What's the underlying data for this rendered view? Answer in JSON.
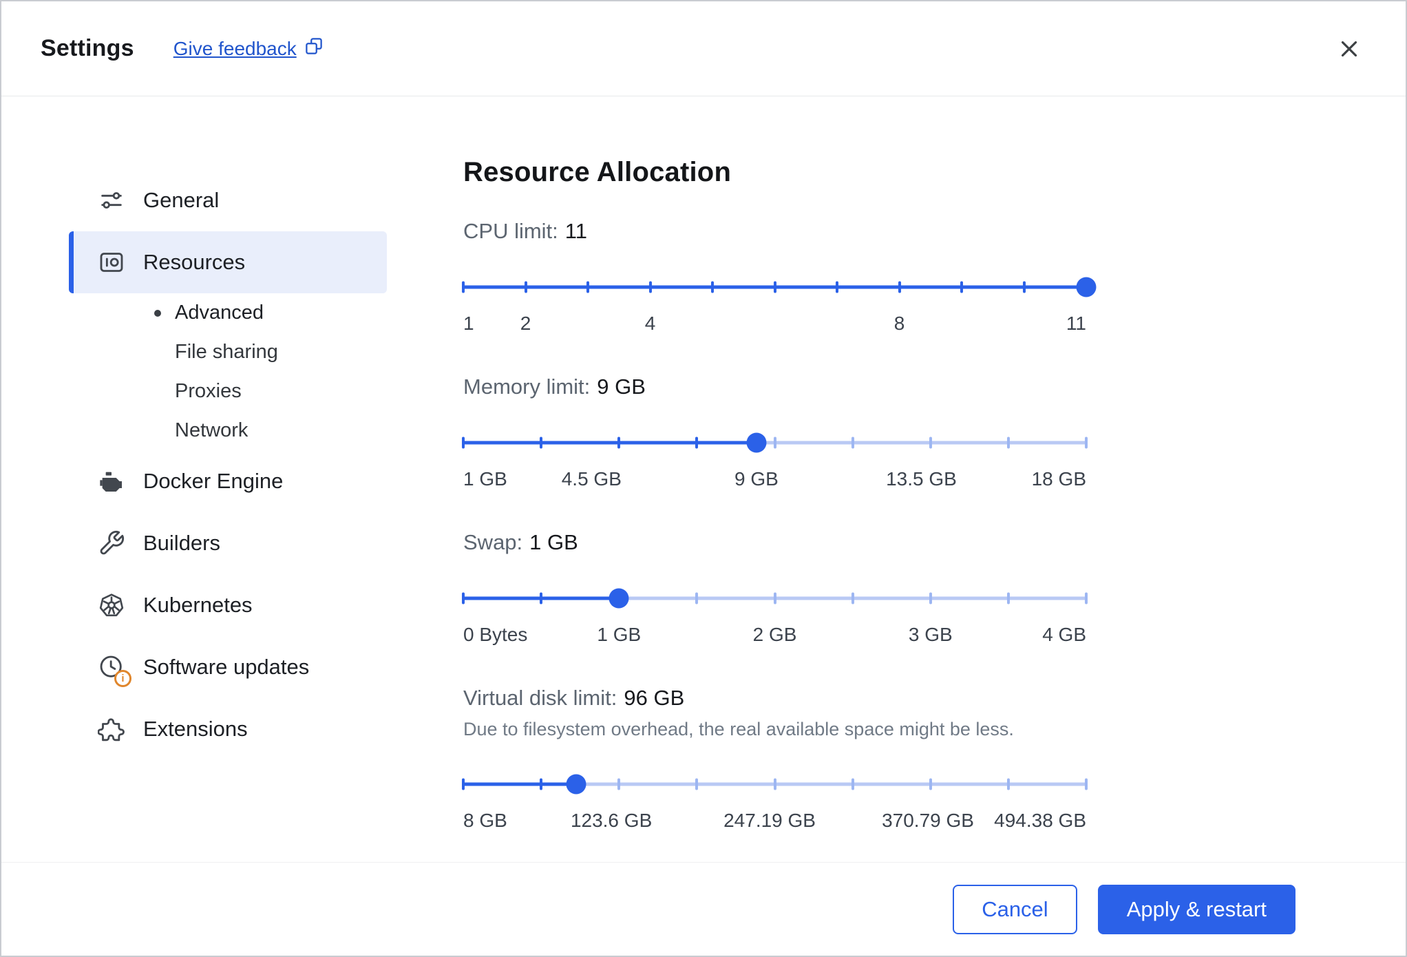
{
  "colors": {
    "accent": "#2b61e8",
    "track_light": "#b9c9f4",
    "tick_light": "#9db6f2",
    "selected_bg": "#e9eefb",
    "warning": "#e0862c",
    "link": "#2155cc"
  },
  "header": {
    "title": "Settings",
    "feedback_label": "Give feedback"
  },
  "sidebar": {
    "items": [
      {
        "type": "item",
        "label": "General",
        "icon": "sliders"
      },
      {
        "type": "item",
        "label": "Resources",
        "icon": "gauge",
        "selected": true
      },
      {
        "type": "sub",
        "label": "Advanced",
        "active": true
      },
      {
        "type": "sub",
        "label": "File sharing"
      },
      {
        "type": "sub",
        "label": "Proxies"
      },
      {
        "type": "sub",
        "label": "Network"
      },
      {
        "type": "item",
        "label": "Docker Engine",
        "icon": "engine"
      },
      {
        "type": "item",
        "label": "Builders",
        "icon": "wrench"
      },
      {
        "type": "item",
        "label": "Kubernetes",
        "icon": "kubernetes"
      },
      {
        "type": "item",
        "label": "Software updates",
        "icon": "clock-update",
        "badge": "info"
      },
      {
        "type": "item",
        "label": "Extensions",
        "icon": "puzzle"
      }
    ]
  },
  "main": {
    "title": "Resource Allocation",
    "sliders": [
      {
        "label": "CPU limit:",
        "value_text": "11",
        "min": 1,
        "max": 11,
        "current": 11,
        "segments": 10,
        "tick_labels": [
          {
            "text": "1",
            "value": 1
          },
          {
            "text": "2",
            "value": 2
          },
          {
            "text": "4",
            "value": 4
          },
          {
            "text": "8",
            "value": 8
          },
          {
            "text": "11",
            "value": 11
          }
        ]
      },
      {
        "label": "Memory limit:",
        "value_text": "9 GB",
        "min": 1,
        "max": 18,
        "current": 9,
        "segments": 8,
        "tick_labels": [
          {
            "text": "1 GB",
            "value": 1
          },
          {
            "text": "4.5 GB",
            "value": 4.5
          },
          {
            "text": "9 GB",
            "value": 9
          },
          {
            "text": "13.5 GB",
            "value": 13.5
          },
          {
            "text": "18 GB",
            "value": 18
          }
        ]
      },
      {
        "label": "Swap:",
        "value_text": "1 GB",
        "min": 0,
        "max": 4,
        "current": 1,
        "segments": 8,
        "tick_labels": [
          {
            "text": "0 Bytes",
            "value": 0
          },
          {
            "text": "1 GB",
            "value": 1
          },
          {
            "text": "2 GB",
            "value": 2
          },
          {
            "text": "3 GB",
            "value": 3
          },
          {
            "text": "4 GB",
            "value": 4
          }
        ]
      },
      {
        "label": "Virtual disk limit:",
        "value_text": "96 GB",
        "note": "Due to filesystem overhead, the real available space might be less.",
        "min": 8,
        "max": 494.38,
        "current": 96,
        "segments": 8,
        "tick_labels": [
          {
            "text": "8 GB",
            "value": 8
          },
          {
            "text": "123.6 GB",
            "value": 123.6
          },
          {
            "text": "247.19 GB",
            "value": 247.19
          },
          {
            "text": "370.79 GB",
            "value": 370.79
          },
          {
            "text": "494.38 GB",
            "value": 494.38
          }
        ]
      }
    ]
  },
  "footer": {
    "cancel_label": "Cancel",
    "apply_label": "Apply & restart"
  }
}
